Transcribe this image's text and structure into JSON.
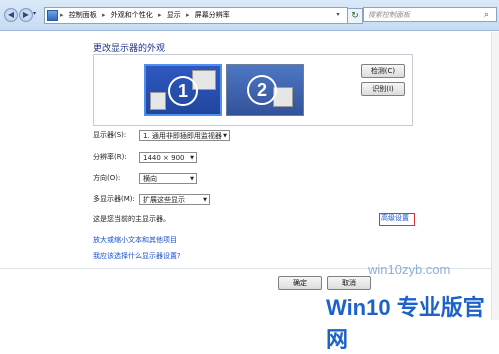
{
  "address_bar": {
    "crumbs": [
      "控制面板",
      "外观和个性化",
      "显示",
      "屏幕分辨率"
    ],
    "separator": "▸",
    "search_placeholder": "搜索控制面板"
  },
  "page": {
    "title": "更改显示器的外观"
  },
  "monitors": [
    {
      "number": "1",
      "selected": true
    },
    {
      "number": "2",
      "selected": false
    }
  ],
  "buttons": {
    "detect": "检测(C)",
    "identify": "识别(I)",
    "ok": "确定",
    "cancel": "取消"
  },
  "settings": [
    {
      "label": "显示器(S):",
      "value": "1. 通用非即插即用监视器"
    },
    {
      "label": "分辨率(R):",
      "value": "1440 × 900"
    },
    {
      "label": "方向(O):",
      "value": "横向"
    },
    {
      "label": "多显示器(M):",
      "value": "扩展这些显示"
    }
  ],
  "info": {
    "primary_text": "这是您当前的主显示器。",
    "advanced_link": "高级设置",
    "link_text_size": "放大或缩小文本和其他项目",
    "link_choose": "我应该选择什么显示器设置?"
  },
  "watermark": {
    "url": "win10zyb.com",
    "logo": "Win10 专业版官网"
  },
  "colors": {
    "title": "#1e3287",
    "link": "#1a4fc4",
    "highlight_box": "#e03030"
  }
}
